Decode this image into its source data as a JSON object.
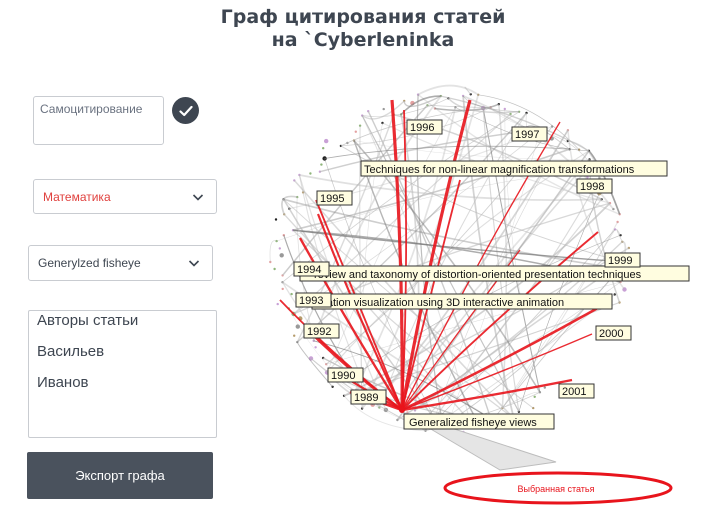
{
  "header": {
    "title_line1": "Граф цитирования статей",
    "title_line2": "на `Cyberleninka"
  },
  "controls": {
    "self_citation_label": "Самоцитирование",
    "self_citation_checked": true,
    "subject_value": "Математика",
    "mode_value": "Generylzed fisheye",
    "authors_options": [
      "Авторы статьи",
      "Васильев",
      "Иванов"
    ],
    "export_label": "Экспорт графа"
  },
  "graph": {
    "year_labels": [
      "1996",
      "1997",
      "1998",
      "1995",
      "1999",
      "1994",
      "1993",
      "1992",
      "2000",
      "1990",
      "1989",
      "2001"
    ],
    "titles": [
      "Techniques for non-linear magnification transformations",
      "review and taxonomy of distortion-oriented presentation techniques",
      "rmation visualization using 3D interactive animation",
      "Generalized fisheye views"
    ],
    "callout_label": "Выбранная статья",
    "colors": {
      "highlight": "#e8141c",
      "edge": "#9a9a9a",
      "label_bg": "#fffde0",
      "text_dark": "#3e4651",
      "accent_red": "#e0413e"
    }
  }
}
